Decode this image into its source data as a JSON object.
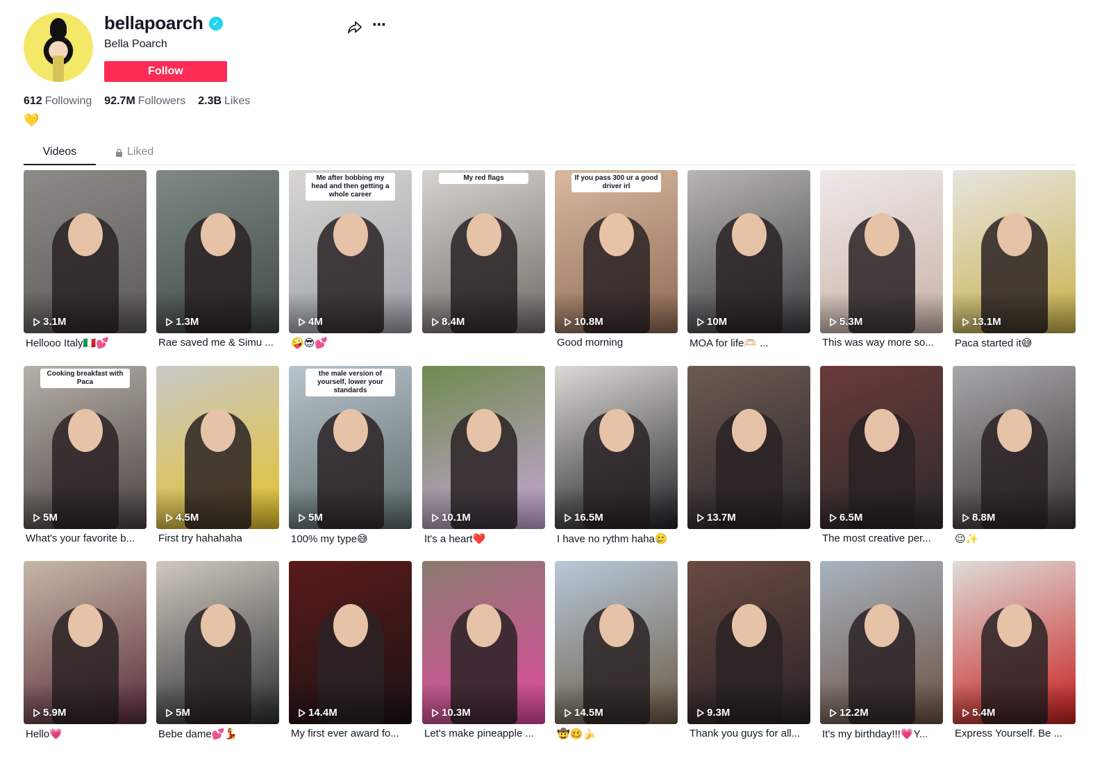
{
  "profile": {
    "username": "bellapoarch",
    "nickname": "Bella Poarch",
    "follow_label": "Follow",
    "bio": "💛",
    "verified_icon": "✓",
    "more_icon": "⋯",
    "colors": {
      "accent": "#fe2c55",
      "verified": "#20d5ec",
      "avatar_bg": "#f4e869"
    }
  },
  "stats": {
    "following_count": "612",
    "following_label": "Following",
    "followers_count": "92.7M",
    "followers_label": "Followers",
    "likes_count": "2.3B",
    "likes_label": "Likes"
  },
  "tabs": {
    "videos": "Videos",
    "liked": "Liked"
  },
  "videos": [
    {
      "views": "3.1M",
      "caption": "Hellooo Italy🇮🇹💕",
      "overlay": "",
      "colors": [
        "#8c8b87",
        "#5a5955"
      ]
    },
    {
      "views": "1.3M",
      "caption": "Rae saved me & Simu ...",
      "overlay": "",
      "colors": [
        "#7f8a86",
        "#3f4845"
      ]
    },
    {
      "views": "4M",
      "caption": "🤪😎💕",
      "overlay": "Me after bobbing my head and then getting a whole career",
      "colors": [
        "#d8d6d2",
        "#9aa0a8"
      ]
    },
    {
      "views": "8.4M",
      "caption": "",
      "overlay": "My red flags",
      "colors": [
        "#d7d4cf",
        "#6f6a66"
      ]
    },
    {
      "views": "10.8M",
      "caption": "Good morning",
      "overlay": "If you pass 300 ur a good driver irl",
      "colors": [
        "#d8b9a0",
        "#8f6a55"
      ]
    },
    {
      "views": "10M",
      "caption": "MOA for life🫶🏻 ...",
      "overlay": "",
      "colors": [
        "#b8b6b4",
        "#3c3c40"
      ]
    },
    {
      "views": "5.3M",
      "caption": "This was way more so...",
      "overlay": "",
      "colors": [
        "#efe9e8",
        "#c9b2a8"
      ]
    },
    {
      "views": "13.1M",
      "caption": "Paca started it😅",
      "overlay": "",
      "colors": [
        "#e7e4e0",
        "#c9b24a"
      ]
    },
    {
      "views": "5M",
      "caption": "What's your favorite b...",
      "overlay": "Cooking breakfast with Paca",
      "colors": [
        "#b7b1aa",
        "#4a4240"
      ]
    },
    {
      "views": "4.5M",
      "caption": "First try hahahaha",
      "overlay": "",
      "colors": [
        "#c9c9c9",
        "#e5c22a"
      ]
    },
    {
      "views": "5M",
      "caption": "100% my type😅",
      "overlay": "the male version of yourself, lower your standards",
      "colors": [
        "#b9c4cc",
        "#5b6a6a"
      ]
    },
    {
      "views": "10.1M",
      "caption": "It's a heart❤️",
      "overlay": "",
      "colors": [
        "#6f8a4e",
        "#c7a7d9"
      ]
    },
    {
      "views": "16.5M",
      "caption": "I have no rythm haha🥲",
      "overlay": "",
      "colors": [
        "#dcdad6",
        "#222226"
      ]
    },
    {
      "views": "13.7M",
      "caption": "",
      "overlay": "",
      "colors": [
        "#6b5a52",
        "#2b2628"
      ]
    },
    {
      "views": "6.5M",
      "caption": "The most creative per...",
      "overlay": "",
      "colors": [
        "#6a3a3a",
        "#2c2a2a"
      ]
    },
    {
      "views": "8.8M",
      "caption": "😉✨",
      "overlay": "",
      "colors": [
        "#a8a8aa",
        "#3a3234"
      ]
    },
    {
      "views": "5.9M",
      "caption": "Hello💗",
      "overlay": "",
      "colors": [
        "#c7b8a8",
        "#5a2c3a"
      ]
    },
    {
      "views": "5M",
      "caption": "Bebe dame💕💃",
      "overlay": "",
      "colors": [
        "#d0c8c0",
        "#2a3030"
      ]
    },
    {
      "views": "14.4M",
      "caption": "My first ever award fo...",
      "overlay": "",
      "colors": [
        "#5a1a1a",
        "#1c1214"
      ]
    },
    {
      "views": "10.3M",
      "caption": "Let's make pineapple ...",
      "overlay": "",
      "colors": [
        "#8a7a6e",
        "#e04aa0"
      ]
    },
    {
      "views": "14.5M",
      "caption": "🤠🥴🍌",
      "overlay": "",
      "colors": [
        "#b8c8d8",
        "#6a5a44"
      ]
    },
    {
      "views": "9.3M",
      "caption": "Thank you guys for all...",
      "overlay": "",
      "colors": [
        "#6a4a42",
        "#2a2226"
      ]
    },
    {
      "views": "12.2M",
      "caption": "It's my birthday!!!💗Y...",
      "overlay": "",
      "colors": [
        "#a8b4c0",
        "#6a5040"
      ]
    },
    {
      "views": "5.4M",
      "caption": "Express Yourself. Be ...",
      "overlay": "",
      "colors": [
        "#dedcd8",
        "#c81e1e"
      ]
    }
  ]
}
